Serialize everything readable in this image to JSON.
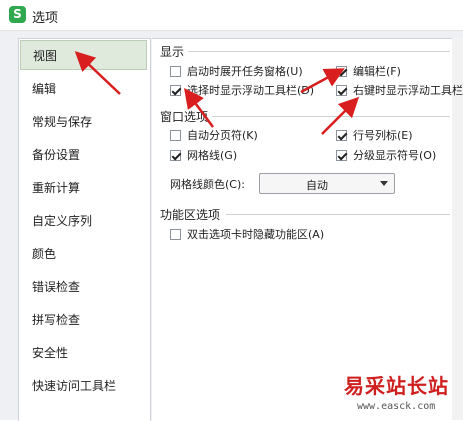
{
  "window": {
    "title": "选项",
    "app_icon_glyph": "S"
  },
  "sidebar": {
    "items": [
      {
        "label": "视图",
        "selected": true
      },
      {
        "label": "编辑"
      },
      {
        "label": "常规与保存"
      },
      {
        "label": "备份设置"
      },
      {
        "label": "重新计算"
      },
      {
        "label": "自定义序列"
      },
      {
        "label": "颜色"
      },
      {
        "label": "错误检查"
      },
      {
        "label": "拼写检查"
      },
      {
        "label": "安全性"
      },
      {
        "label": "快速访问工具栏"
      }
    ]
  },
  "display": {
    "title": "显示",
    "options": [
      {
        "label": "启动时展开任务窗格(U)",
        "checked": false
      },
      {
        "label": "编辑栏(F)",
        "checked": true
      },
      {
        "label": "选择时显示浮动工具栏(D)",
        "checked": true
      },
      {
        "label": "右键时显示浮动工具栏(M)",
        "checked": true
      }
    ]
  },
  "window_options": {
    "title": "窗口选项",
    "options": [
      {
        "label": "自动分页符(K)",
        "checked": false
      },
      {
        "label": "行号列标(E)",
        "checked": true
      },
      {
        "label": "网格线(G)",
        "checked": true
      },
      {
        "label": "分级显示符号(O)",
        "checked": true
      }
    ],
    "grid_color_label": "网格线颜色(C):",
    "grid_color_value": "自动"
  },
  "ribbon": {
    "title": "功能区选项",
    "options": [
      {
        "label": "双击选项卡时隐藏功能区(A)",
        "checked": false
      }
    ]
  },
  "watermark": {
    "text": "易采站长站",
    "url": "www.easck.com"
  },
  "colors": {
    "brand": "#2fa84f",
    "arrow": "#d81e1e",
    "selected_bg": "#dfe9dc"
  }
}
